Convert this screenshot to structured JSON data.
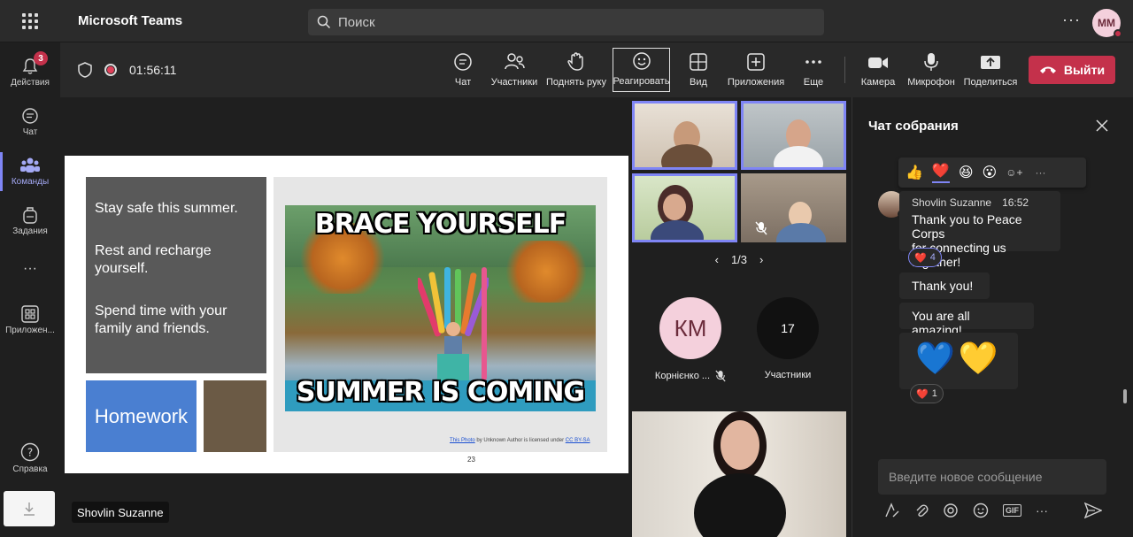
{
  "app": {
    "title": "Microsoft Teams",
    "search_placeholder": "Поиск",
    "more": "···",
    "user_initials": "ММ"
  },
  "rail": {
    "items": [
      {
        "label": "Действия",
        "badge": "3"
      },
      {
        "label": "Чат"
      },
      {
        "label": "Команды"
      },
      {
        "label": "Задания"
      },
      {
        "label": "···"
      },
      {
        "label": "Приложен..."
      },
      {
        "label": "Справка"
      }
    ]
  },
  "meeting": {
    "timer": "01:56:11",
    "tools": {
      "chat": "Чат",
      "participants": "Участники",
      "raise_hand": "Поднять руку",
      "react": "Реагировать",
      "view": "Вид",
      "apps": "Приложения",
      "more": "Еще",
      "camera": "Камера",
      "mic": "Микрофон",
      "share": "Поделиться"
    },
    "leave": "Выйти",
    "presenter_tag": "Shovlin Suzanne"
  },
  "slide": {
    "bullets": [
      "Stay safe this summer.",
      "Rest and recharge yourself.",
      "Spend time with your family and friends."
    ],
    "homework": "Homework",
    "meme_top": "BRACE YOURSELF",
    "meme_bottom": "SUMMER IS COMING",
    "credit_link1": "This Photo",
    "credit_mid": " by Unknown Author is licensed under ",
    "credit_link2": "CC BY-SA",
    "page_number": "23"
  },
  "gallery": {
    "pager": "1/3",
    "participant_initials": "КМ",
    "participant_name": "Корнієнко ...",
    "participants_count": "17",
    "participants_label": "Участники"
  },
  "chat": {
    "title": "Чат собрания",
    "reactions": [
      "👍",
      "❤️",
      "😆",
      "😮",
      "☺+"
    ],
    "messages": [
      {
        "author": "Shovlin Suzanne",
        "time": "16:52",
        "text1": "Thank you to Peace Corps",
        "text2": "for connecting us together!",
        "reaction_count": "4"
      },
      {
        "text": "Thank you!"
      },
      {
        "text": "You are all amazing!"
      },
      {
        "hearts": "💙💛",
        "reaction_count": "1"
      }
    ],
    "compose_placeholder": "Введите новое сообщение",
    "compose_gif": "GIF"
  },
  "colors": {
    "accent": "#7f85f5",
    "leave": "#c4314b",
    "bg": "#1f1f1f"
  }
}
